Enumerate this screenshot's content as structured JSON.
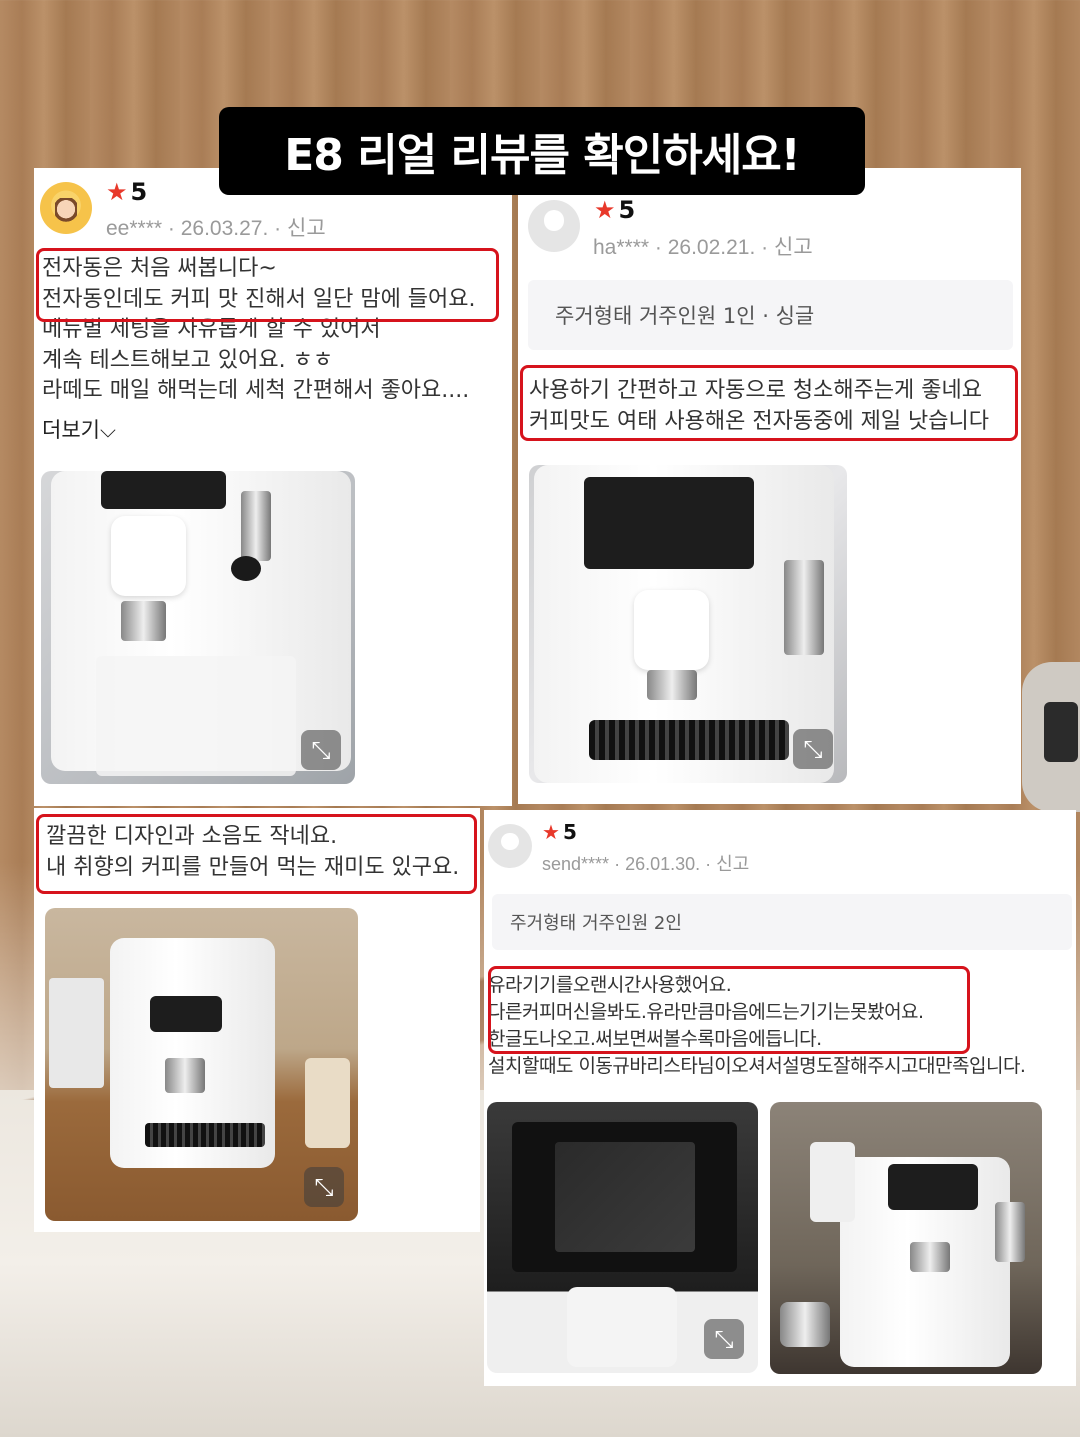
{
  "banner": {
    "title": "E8 리얼 리뷰를 확인하세요!"
  },
  "reviews": [
    {
      "rating": "5",
      "user": "ee****",
      "date": "26.03.27.",
      "report": "신고",
      "lines": [
        "전자동은 처음 써봅니다~",
        "전자동인데도 커피 맛 진해서 일단 맘에 들어요.",
        "메뉴별 세팅을 자유롭게 할 수 있어서",
        "계속 테스트해보고 있어요. ㅎㅎ",
        "라떼도 매일 해먹는데 세척 간편해서 좋아요...."
      ],
      "more": "더보기"
    },
    {
      "rating": "5",
      "user": "ha****",
      "date": "26.02.21.",
      "report": "신고",
      "info": "주거형태 거주인원 1인 · 싱글",
      "lines": [
        "사용하기 간편하고 자동으로 청소해주는게 좋네요",
        "커피맛도 여태 사용해온 전자동중에 제일 낫습니다"
      ]
    },
    {
      "lines": [
        "깔끔한 디자인과 소음도 작네요.",
        "내 취향의 커피를 만들어 먹는 재미도 있구요."
      ]
    },
    {
      "rating": "5",
      "user": "send****",
      "date": "26.01.30.",
      "report": "신고",
      "info": "주거형태 거주인원 2인",
      "lines": [
        "유라기기를오랜시간사용했어요.",
        "다른커피머신을봐도.유라만큼마음에드는기기는못봤어요.",
        "한글도나오고.써보면써볼수록마음에듭니다.",
        "설치할때도 이동규바리스타님이오셔서설명도잘해주시고대만족입니다."
      ]
    }
  ],
  "icons": {
    "star": "star-icon",
    "expand": "expand-icon",
    "chevron": "chevron-down-icon"
  },
  "colors": {
    "highlight": "#d6131c",
    "star": "#e8382a",
    "banner_bg": "#000000"
  }
}
